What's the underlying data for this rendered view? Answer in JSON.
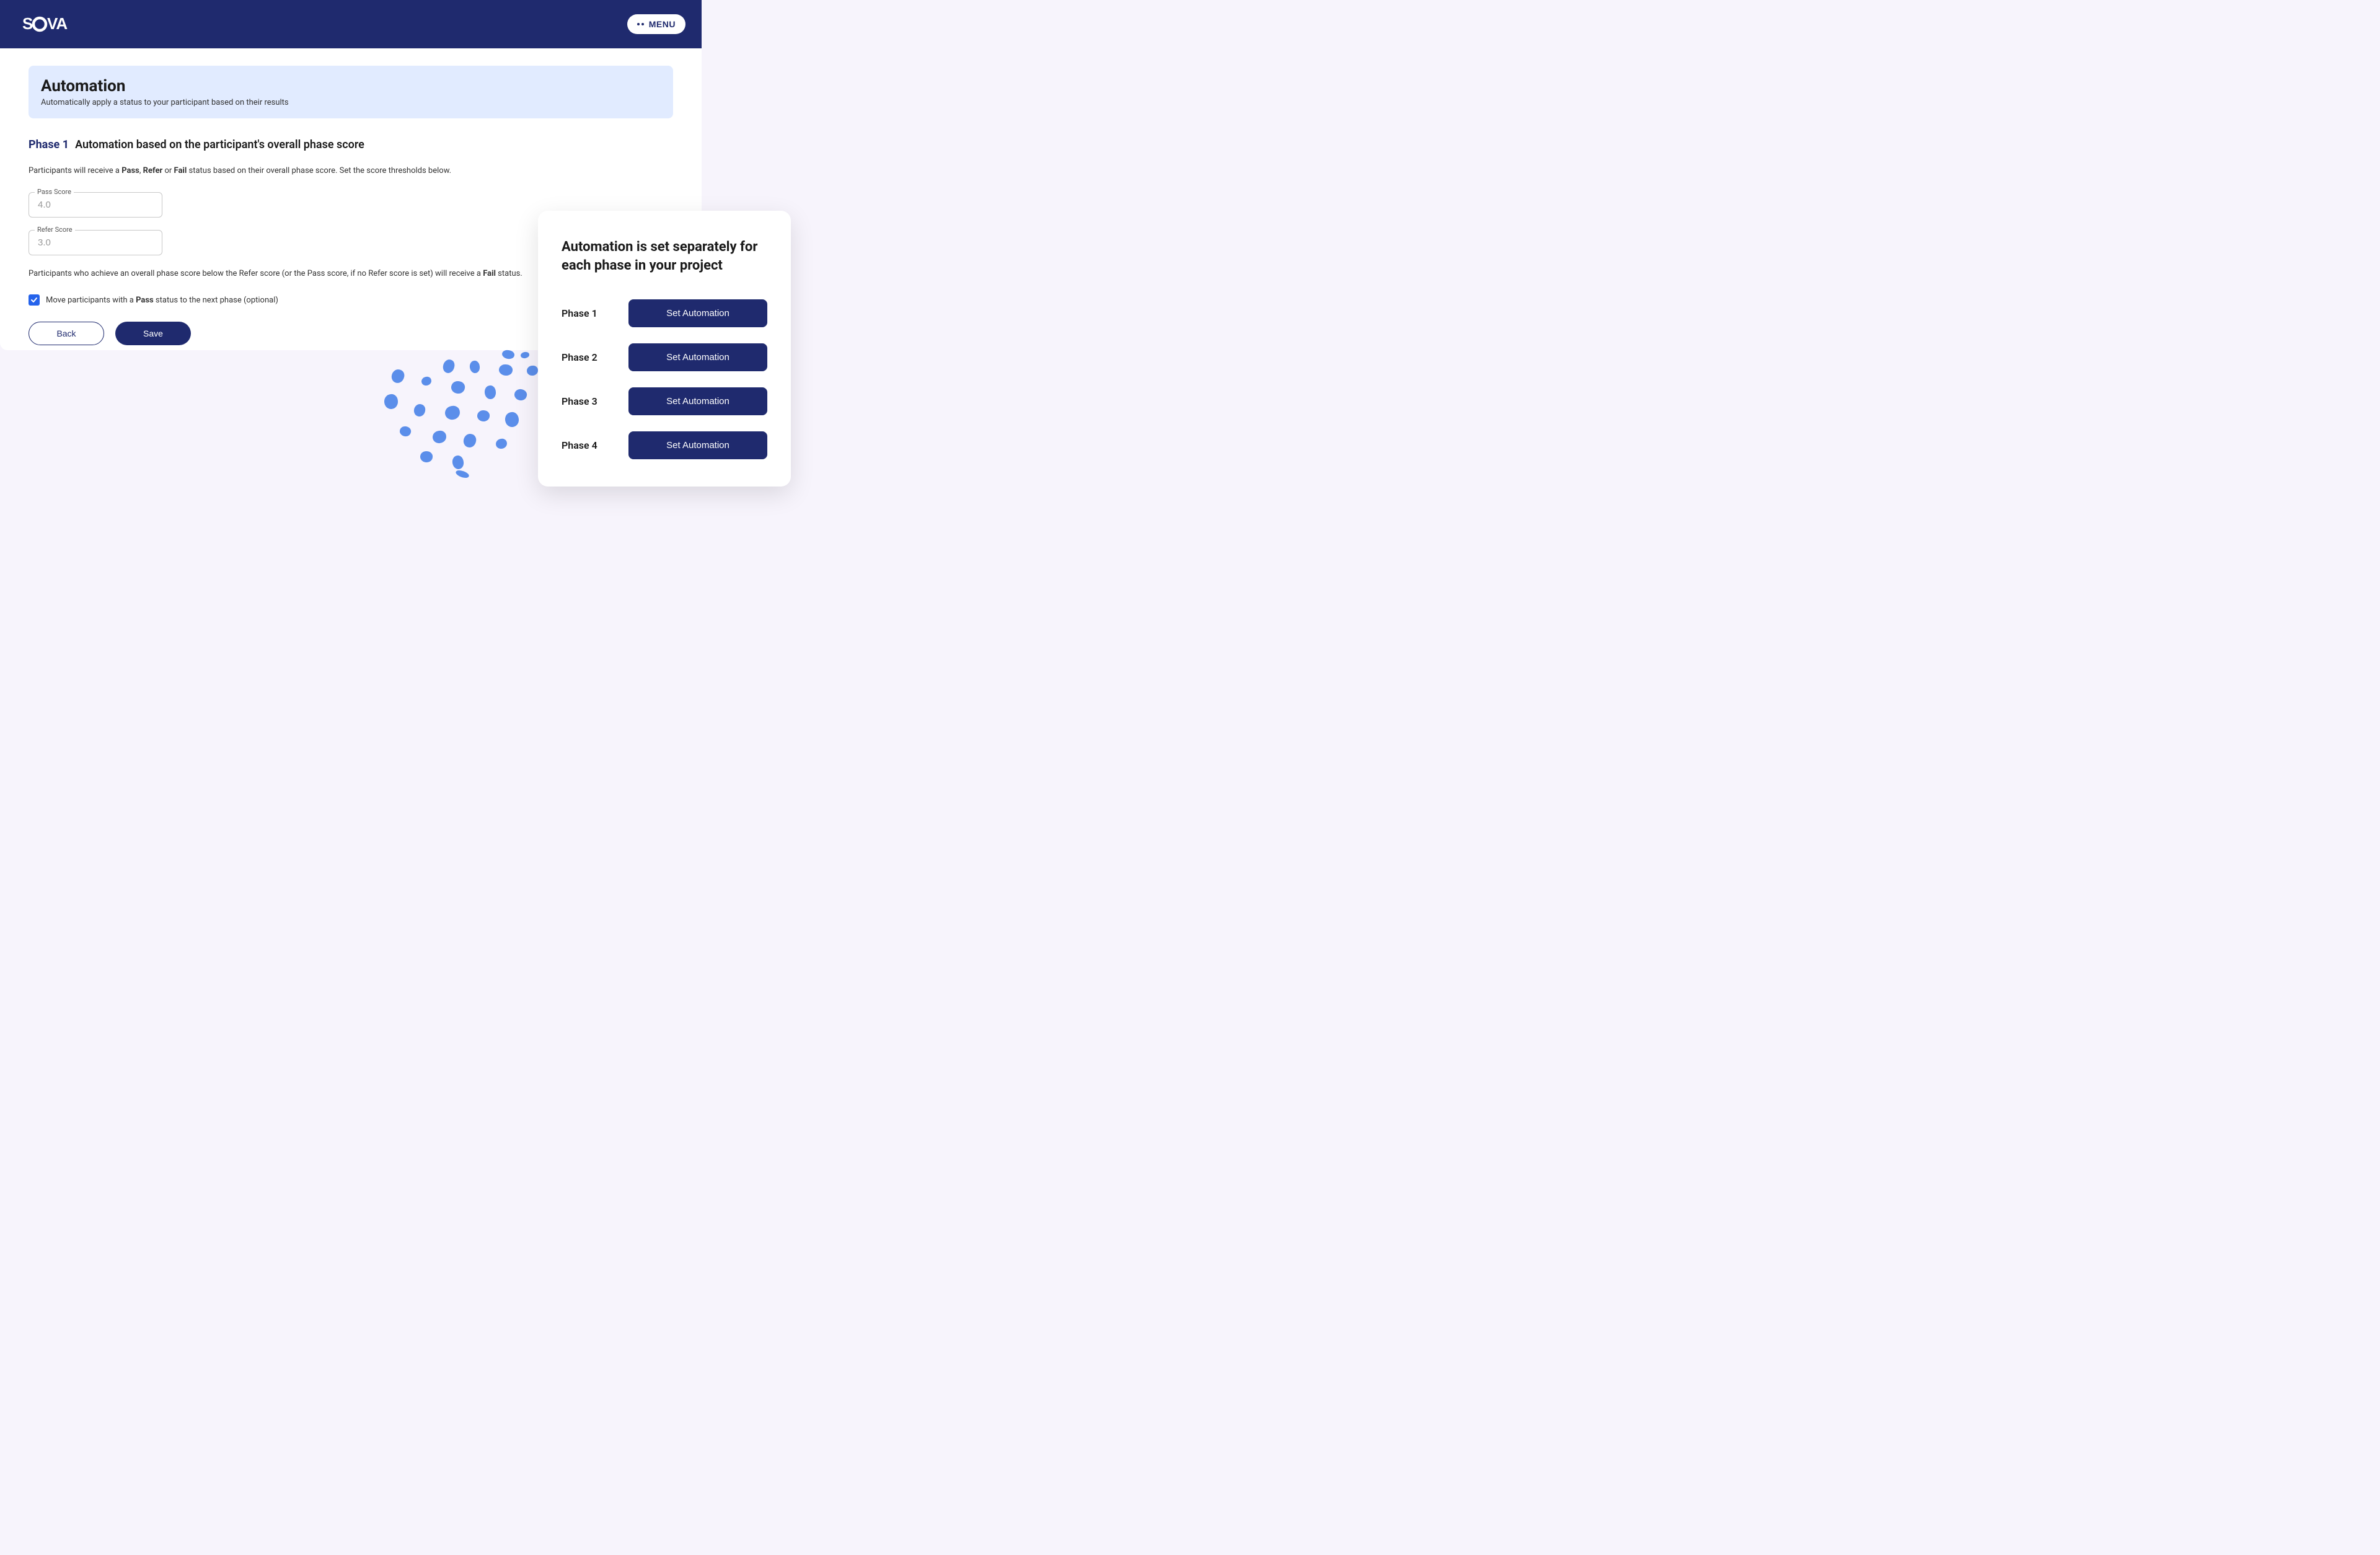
{
  "header": {
    "logo_text": "SOVA",
    "menu_label": "MENU"
  },
  "banner": {
    "title": "Automation",
    "subtitle": "Automatically apply a status to your participant based on their results"
  },
  "section": {
    "phase_label": "Phase 1",
    "title": "Automation based on the participant's overall phase score",
    "intro_prefix": "Participants will receive a ",
    "intro_pass": "Pass",
    "intro_sep1": ", ",
    "intro_refer": "Refer",
    "intro_sep2": " or ",
    "intro_fail": "Fail",
    "intro_suffix": " status based on their overall phase score. Set the score thresholds below.",
    "pass_score_label": "Pass Score",
    "pass_score_placeholder": "4.0",
    "refer_score_label": "Refer Score",
    "refer_score_placeholder": "3.0",
    "note_prefix": "Participants who achieve an overall phase score below the Refer score (or the Pass score, if no Refer score is set) will receive a ",
    "note_fail": "Fail",
    "note_suffix": " status.",
    "checkbox_prefix": "Move participants with a ",
    "checkbox_pass": "Pass",
    "checkbox_suffix": " status to the next phase (optional)",
    "back_label": "Back",
    "save_label": "Save"
  },
  "side": {
    "heading": "Automation is set separately for each phase in your project",
    "phases": [
      {
        "label": "Phase 1",
        "button": "Set Automation"
      },
      {
        "label": "Phase 2",
        "button": "Set Automation"
      },
      {
        "label": "Phase 3",
        "button": "Set Automation"
      },
      {
        "label": "Phase 4",
        "button": "Set Automation"
      }
    ]
  }
}
